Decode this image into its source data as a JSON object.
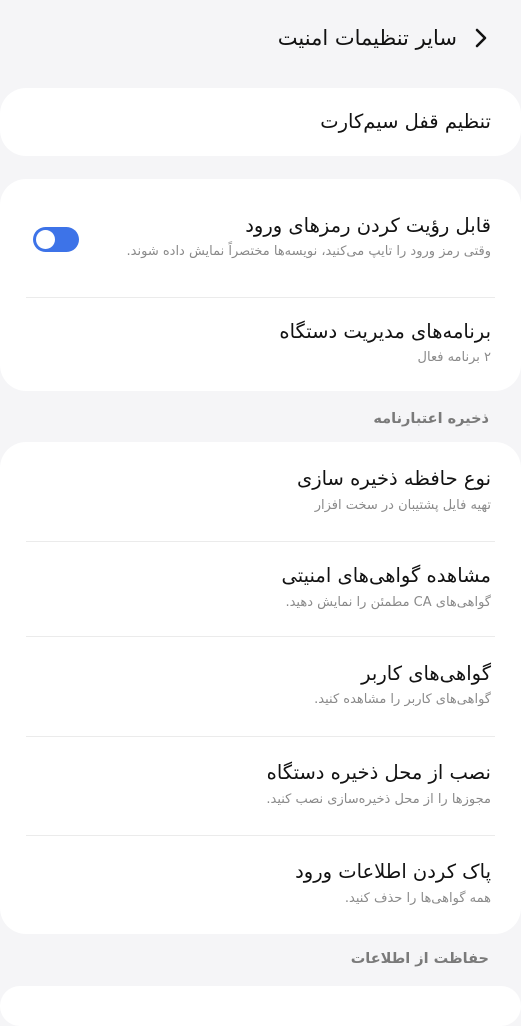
{
  "header": {
    "title": "سایر تنظیمات امنیت"
  },
  "sim_lock_card": {
    "title": "تنظیم قفل سیم‌کارت"
  },
  "passwords_card": {
    "show_passwords": {
      "title": "قابل رؤیت کردن رمزهای ورود",
      "subtitle": "وقتی رمز ورود را تایپ می‌کنید، نویسه‌ها مختصراً نمایش داده شوند.",
      "enabled": true
    },
    "device_admin": {
      "title": "برنامه‌های مدیریت دستگاه",
      "subtitle": "۲ برنامه فعال"
    }
  },
  "credential_storage": {
    "section_title": "ذخیره اعتبارنامه",
    "items": [
      {
        "title": "نوع حافظه ذخیره سازی",
        "subtitle": "تهیه فایل پشتیبان در سخت افزار"
      },
      {
        "title": "مشاهده گواهی‌های امنیتی",
        "subtitle": "گواهی‌های CA مطمئن را نمایش دهید."
      },
      {
        "title": "گواهی‌های کاربر",
        "subtitle": "گواهی‌های کاربر را مشاهده کنید."
      },
      {
        "title": "نصب از محل ذخیره دستگاه",
        "subtitle": "مجوزها را از محل ذخیره‌سازی نصب کنید."
      },
      {
        "title": "پاک کردن اطلاعات ورود",
        "subtitle": "همه گواهی‌ها را حذف کنید."
      }
    ]
  },
  "data_protection": {
    "section_title": "حفاظت از اطلاعات"
  },
  "colors": {
    "accent": "#3d73e8",
    "background": "#f5f5f7",
    "card": "#ffffff"
  }
}
